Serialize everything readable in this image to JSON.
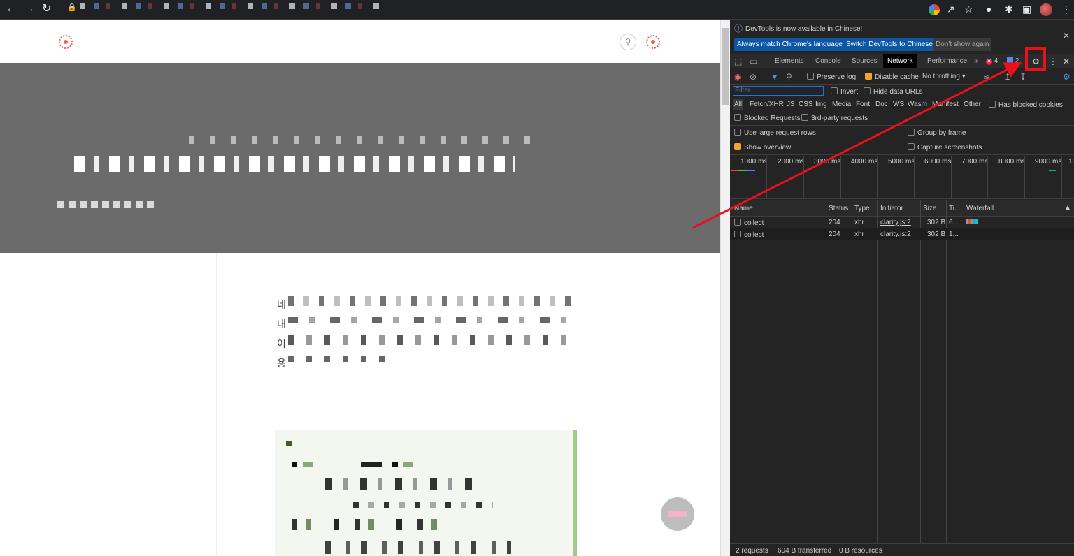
{
  "devtools": {
    "banner": {
      "message": "DevTools is now available in Chinese!",
      "btn_match": "Always match Chrome's language",
      "btn_switch": "Switch DevTools to Chinese",
      "btn_dont_show": "Don't show again"
    },
    "tabs": [
      "Elements",
      "Console",
      "Sources",
      "Network",
      "Performance"
    ],
    "active_tab": "Network",
    "error_count": "4",
    "message_count": "2",
    "toolbar": {
      "preserve_log": "Preserve log",
      "disable_cache": "Disable cache",
      "throttling": "No throttling"
    },
    "filter": {
      "placeholder": "Filter",
      "invert": "Invert",
      "hide_data_urls": "Hide data URLs"
    },
    "type_filters": [
      "All",
      "Fetch/XHR",
      "JS",
      "CSS",
      "Img",
      "Media",
      "Font",
      "Doc",
      "WS",
      "Wasm",
      "Manifest",
      "Other"
    ],
    "has_blocked_cookies": "Has blocked cookies",
    "blocked_requests": "Blocked Requests",
    "third_party": "3rd-party requests",
    "options": {
      "large_rows": "Use large request rows",
      "group_by_frame": "Group by frame",
      "show_overview": "Show overview",
      "capture_screenshots": "Capture screenshots"
    },
    "timeline_labels": [
      "1000 ms",
      "2000 ms",
      "3000 ms",
      "4000 ms",
      "5000 ms",
      "6000 ms",
      "7000 ms",
      "8000 ms",
      "9000 ms",
      "10"
    ],
    "columns": [
      "Name",
      "Status",
      "Type",
      "Initiator",
      "Size",
      "Ti...",
      "Waterfall"
    ],
    "requests": [
      {
        "name": "collect",
        "status": "204",
        "type": "xhr",
        "initiator": "clarity.js:2",
        "size": "302 B",
        "time": "6..."
      },
      {
        "name": "collect",
        "status": "204",
        "type": "xhr",
        "initiator": "clarity.js:2",
        "size": "302 B",
        "time": "1..."
      }
    ],
    "status": {
      "requests": "2 requests",
      "transferred": "604 B transferred",
      "resources": "0 B resources"
    }
  },
  "page": {
    "para_starts": [
      "네",
      "내",
      "이",
      "용"
    ]
  },
  "colors": {
    "annotation_red": "#e8101a",
    "hero_gray": "#6b6b6b",
    "accent_orange": "#e8644a",
    "devtools_blue": "#0b57a6"
  }
}
